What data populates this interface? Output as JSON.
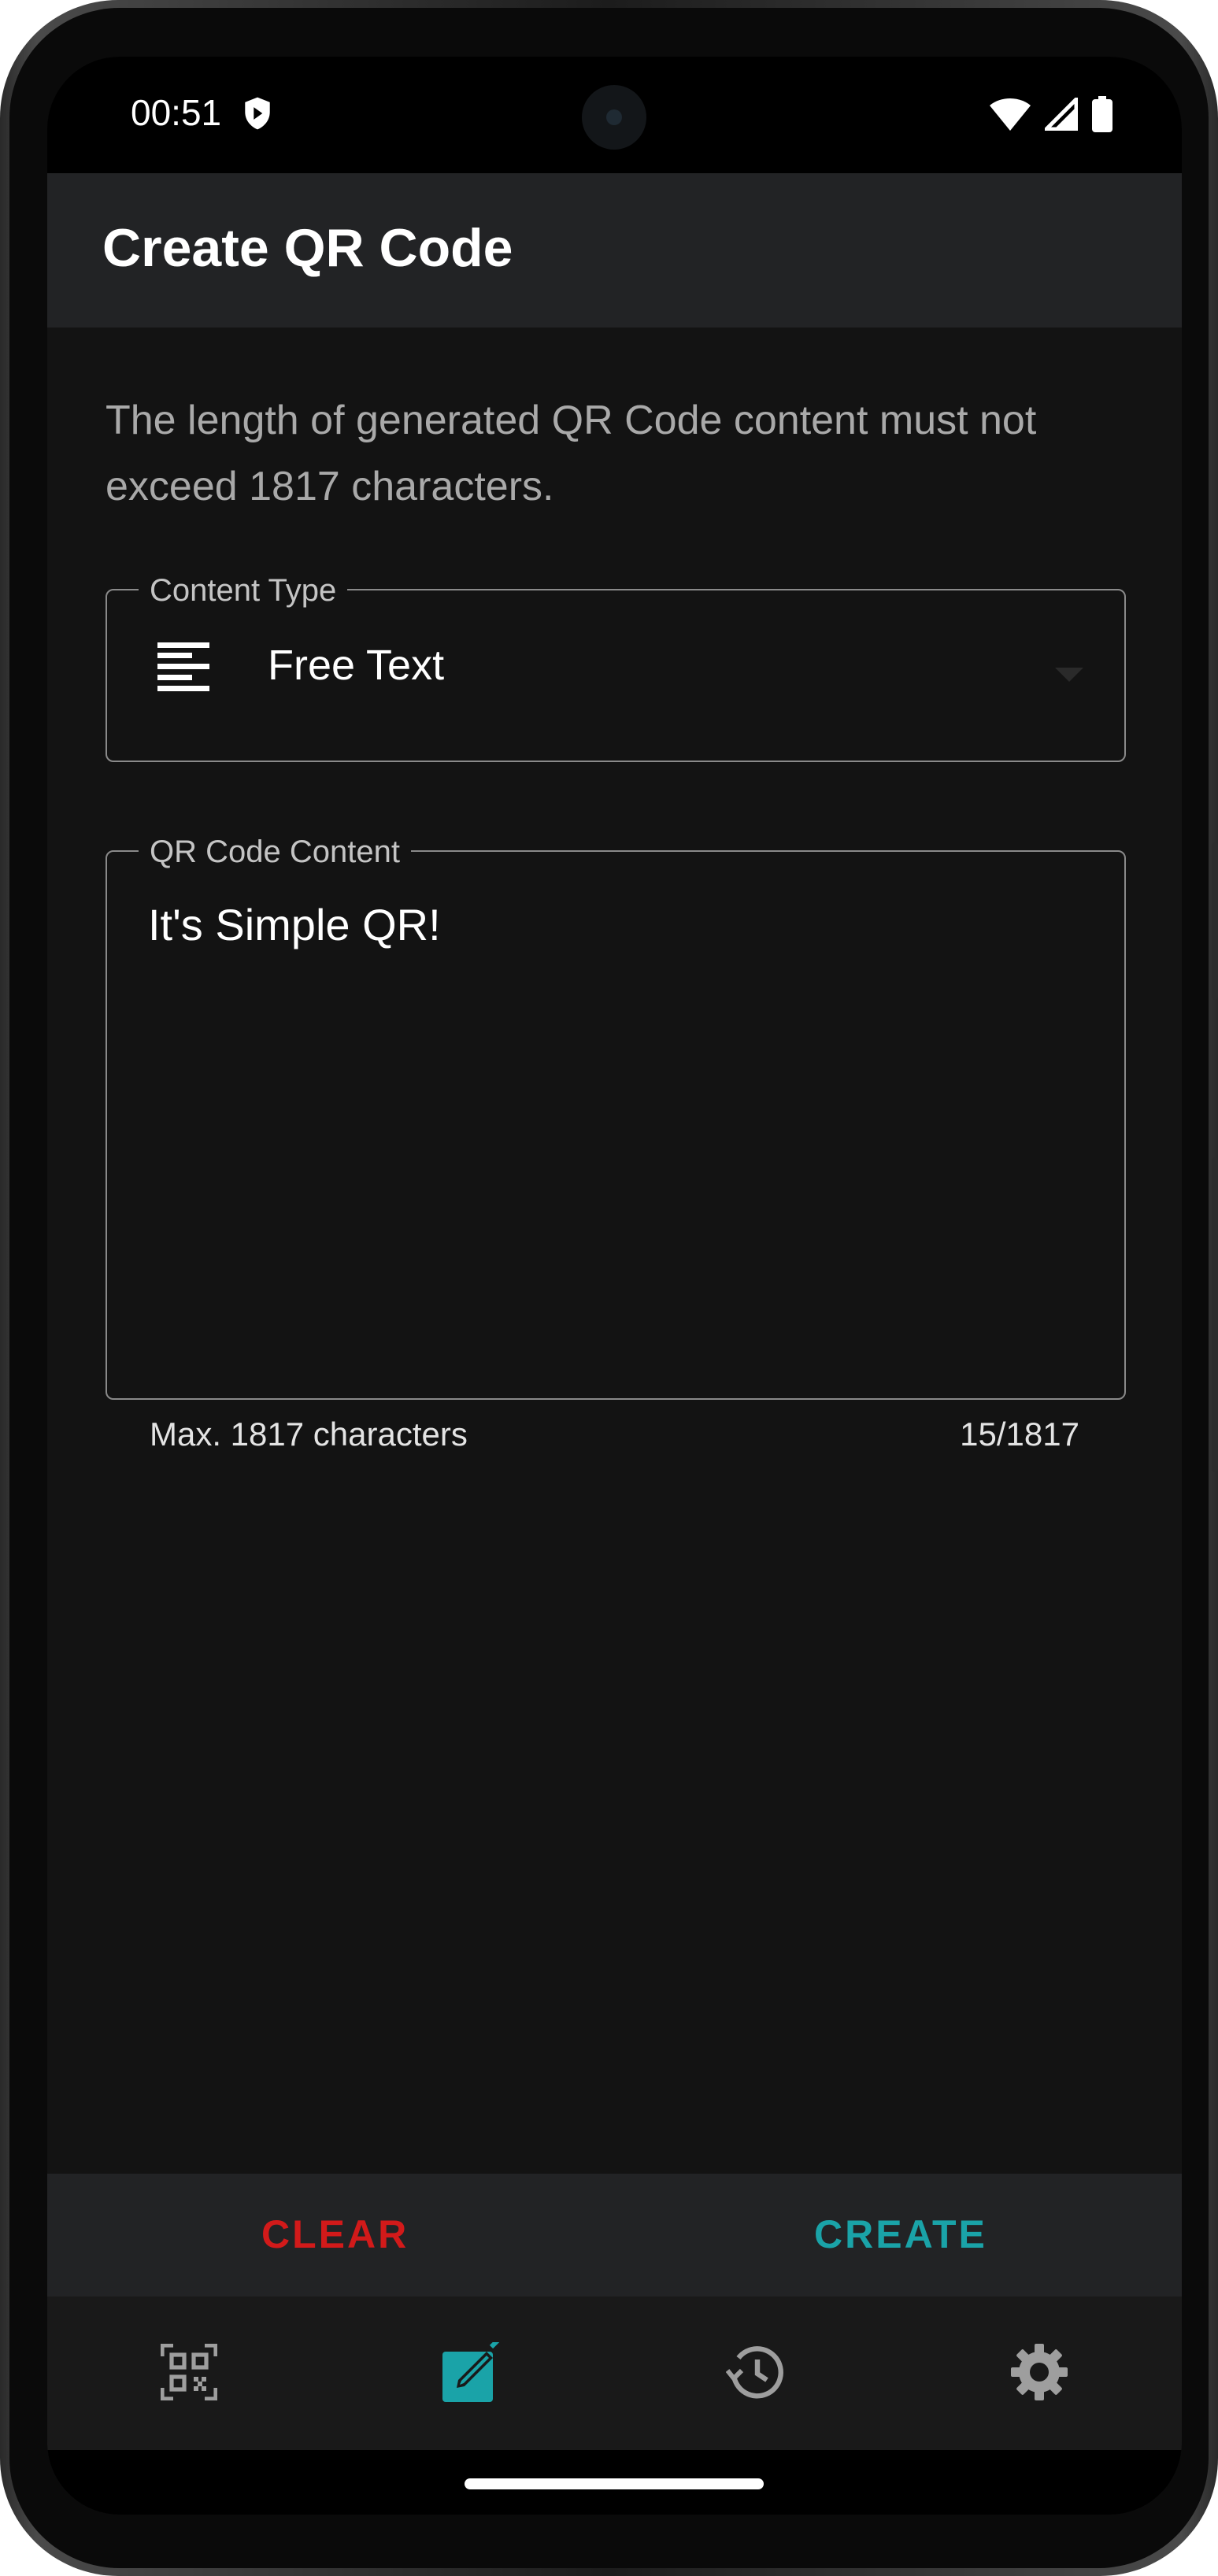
{
  "status_bar": {
    "time": "00:51",
    "icons": [
      "shield-icon",
      "wifi-icon",
      "signal-icon",
      "battery-icon"
    ]
  },
  "app_bar": {
    "title": "Create QR Code"
  },
  "info_text": " The length of generated QR Code content must not exceed 1817 characters.",
  "content_type": {
    "label": "Content Type",
    "value": "Free Text",
    "icon": "free-text-icon"
  },
  "qr_content": {
    "label": "QR Code Content",
    "value": "It's Simple QR!",
    "helper": "Max. 1817 characters",
    "counter": "15/1817"
  },
  "actions": {
    "clear_label": "CLEAR",
    "create_label": "CREATE"
  },
  "bottom_nav": {
    "items": [
      {
        "icon": "qr-scan-icon",
        "active": false
      },
      {
        "icon": "create-edit-icon",
        "active": true
      },
      {
        "icon": "history-icon",
        "active": false
      },
      {
        "icon": "settings-icon",
        "active": false
      }
    ]
  },
  "colors": {
    "background": "#131313",
    "app_bar": "#222325",
    "accent": "#1aa3a8",
    "clear": "#d21a1a",
    "inactive_icon": "#9e9e9e"
  }
}
